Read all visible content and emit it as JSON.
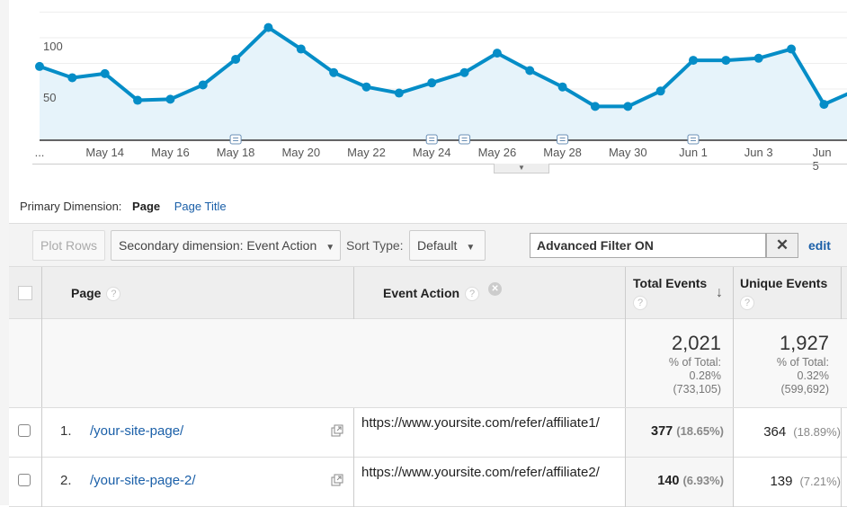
{
  "chart_data": {
    "type": "area",
    "x": [
      "May 12",
      "May 13",
      "May 14",
      "May 15",
      "May 16",
      "May 17",
      "May 18",
      "May 19",
      "May 20",
      "May 21",
      "May 22",
      "May 23",
      "May 24",
      "May 25",
      "May 26",
      "May 27",
      "May 28",
      "May 29",
      "May 30",
      "May 31",
      "Jun 1",
      "Jun 2",
      "Jun 3",
      "Jun 4",
      "Jun 5",
      "Jun 6"
    ],
    "values": [
      72,
      61,
      65,
      39,
      40,
      54,
      79,
      110,
      89,
      66,
      52,
      46,
      56,
      66,
      85,
      68,
      52,
      33,
      33,
      48,
      78,
      78,
      80,
      89,
      35,
      49
    ],
    "x_tick_labels": [
      "...",
      "May 14",
      "May 16",
      "May 18",
      "May 20",
      "May 22",
      "May 24",
      "May 26",
      "May 28",
      "May 30",
      "Jun 1",
      "Jun 3",
      "Jun 5"
    ],
    "y_tick_labels": [
      "150",
      "100",
      "50"
    ],
    "ylim": [
      0,
      150
    ],
    "grid": true,
    "line_color": "#058dc7",
    "fill_color": "#e6f3fa",
    "annotation_icons": [
      "May 18",
      "May 24",
      "May 25",
      "May 28",
      "Jun 1"
    ]
  },
  "primary_dimension": {
    "label": "Primary Dimension:",
    "active": "Page",
    "other": "Page Title"
  },
  "toolbar": {
    "plot_rows": "Plot Rows",
    "secondary_dimension": "Secondary dimension: Event Action",
    "sort_type_label": "Sort Type:",
    "sort_type": "Default",
    "filter": "Advanced Filter ON",
    "edit": "edit"
  },
  "table": {
    "headers": {
      "page": "Page",
      "event_action": "Event Action",
      "total_events": "Total Events",
      "unique_events": "Unique Events",
      "help": "?"
    },
    "summary": {
      "total_events": {
        "value": "2,021",
        "pct_label": "% of Total:",
        "pct": "0.28%",
        "total": "(733,105)"
      },
      "unique_events": {
        "value": "1,927",
        "pct_label": "% of Total:",
        "pct": "0.32%",
        "total": "(599,692)"
      }
    },
    "rows": [
      {
        "num": "1.",
        "page": "/your-site-page/",
        "event_action": "https://www.yoursite.com/refer/affiliate1/",
        "total": "377",
        "total_pct": "(18.65%)",
        "unique": "364",
        "unique_pct": "(18.89%)"
      },
      {
        "num": "2.",
        "page": "/your-site-page-2/",
        "event_action": "https://www.yoursite.com/refer/affiliate2/",
        "total": "140",
        "total_pct": "(6.93%)",
        "unique": "139",
        "unique_pct": "(7.21%)"
      }
    ]
  }
}
